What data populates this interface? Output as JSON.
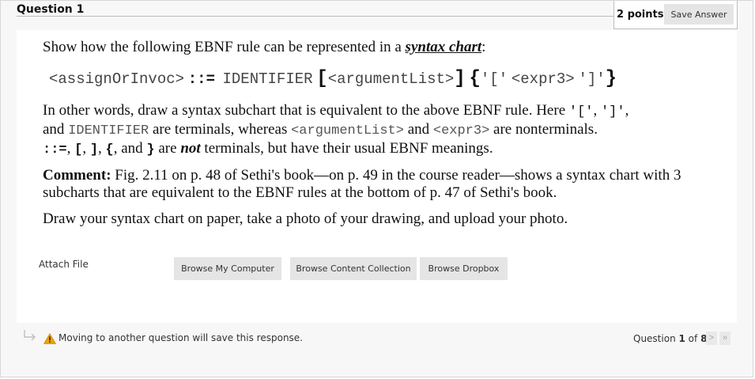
{
  "question": {
    "title": "Question 1",
    "points": "2 points",
    "save_label": "Save Answer"
  },
  "content": {
    "intro": "Show how the following EBNF rule can be represented in a ",
    "intro_link": "syntax chart",
    "intro_end": ":",
    "rule": {
      "lhs": "<assignOrInvoc>",
      "op": "::=",
      "ident": "IDENTIFIER",
      "lbr": "[",
      "arg": "<argumentList>",
      "rbr": "]",
      "lbrace": "{",
      "q_open": "'['",
      "expr": "<expr3>",
      "q_close": "']'",
      "rbrace": "}"
    },
    "p2": {
      "t1": "In other words, draw a syntax subchart that is equivalent to the above EBNF rule.  Here ",
      "m1": "'['",
      "c1": ", ",
      "m2": "']'",
      "c2": ",",
      "t2": "and ",
      "m3": "IDENTIFIER",
      "t3": " are terminals, whereas ",
      "m4": "<argumentList>",
      "t4": " and ",
      "m5": "<expr3>",
      "t5": "  are nonterminals.",
      "m6": "::=",
      "t6": ", ",
      "b1": "[",
      "t7": ",  ",
      "b2": "]",
      "t8": ",  ",
      "b3": "{",
      "t9": ", and  ",
      "b4": "}",
      "t10": " are ",
      "not": "not",
      "t11": "  terminals, but have their usual EBNF meanings."
    },
    "comment_label": "Comment:",
    "comment_text": " Fig. 2.11 on p. 48 of Sethi's book—on p. 49 in the course reader—shows a syntax chart with 3 subcharts that are equivalent to the EBNF rules at the bottom of p. 47 of Sethi's book.",
    "instruction": "Draw your syntax chart on paper, take a photo of your drawing, and upload your photo."
  },
  "attach": {
    "label": "Attach File",
    "buttons": [
      "Browse My Computer",
      "Browse Content Collection",
      "Browse Dropbox"
    ]
  },
  "footer": {
    "note": "Moving to another question will save this response.",
    "nav_prefix": "Question ",
    "current": "1",
    "nav_of": " of ",
    "total": "8",
    "next": ">",
    "last": "»"
  },
  "icons": [
    "arrow-return-icon",
    "warning-icon",
    "next-icon",
    "last-icon"
  ],
  "colors": {
    "button_bg": "#e5e5e5",
    "warning": "#f0a500"
  }
}
